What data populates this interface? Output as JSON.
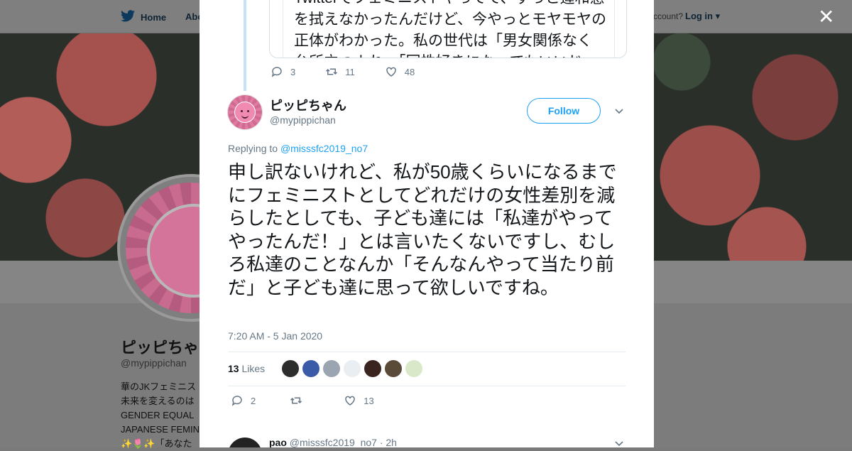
{
  "background": {
    "nav": {
      "home": "Home",
      "about": "Abo",
      "account_text": "ccount?",
      "login": "Log in"
    },
    "profile": {
      "name": "ピッピちゃ",
      "handle": "@mypippichan",
      "bio_lines": [
        "華のJKフェミニス",
        "未来を変えるのは",
        "GENDER EQUAL",
        "JAPANESE FEMIN",
        "✨🌷✨「あなた"
      ]
    }
  },
  "modal": {
    "close_icon": "close-icon",
    "quoted": {
      "text": "Twitterでフェミニストやってて、ずっと違和感を拭えなかったんだけど、今やっとモヤモヤの正体がわかった。私の世代は「男女関係なく台所立つよね」「同性好きになってもいいじ"
    },
    "prev_actions": {
      "replies": "3",
      "retweets": "11",
      "likes": "48"
    },
    "author": {
      "name": "ピッピちゃん",
      "handle": "@mypippichan",
      "follow_label": "Follow"
    },
    "replying": {
      "prefix": "Replying to",
      "to": "@misssfc2019_no7"
    },
    "tweet_text": "申し訳ないけれど、私が50歳くらいになるまでにフェミニストとしてどれだけの女性差別を減らしたとしても、子ども達には「私達がやってやったんだ！」とは言いたくないですし、むしろ私達のことなんか「そんなんやって当たり前だ」と子ども達に思って欲しいですね。",
    "timestamp": "7:20 AM - 5 Jan 2020",
    "likes": {
      "count": "13",
      "label": "Likes",
      "liker_colors": [
        "#2d2d2d",
        "#3b5aa8",
        "#9aa5b1",
        "#e8eef2",
        "#3a2420",
        "#5a4a38",
        "#d8e8c8"
      ]
    },
    "actions": {
      "replies": "2",
      "retweets": "",
      "likes": "13"
    },
    "next_reply": {
      "name": "pao",
      "handle": "@misssfc2019_no7",
      "time": "· 2h"
    },
    "colors": {
      "accent": "#1da1f2",
      "text": "#14171a",
      "muted": "#657786"
    }
  }
}
